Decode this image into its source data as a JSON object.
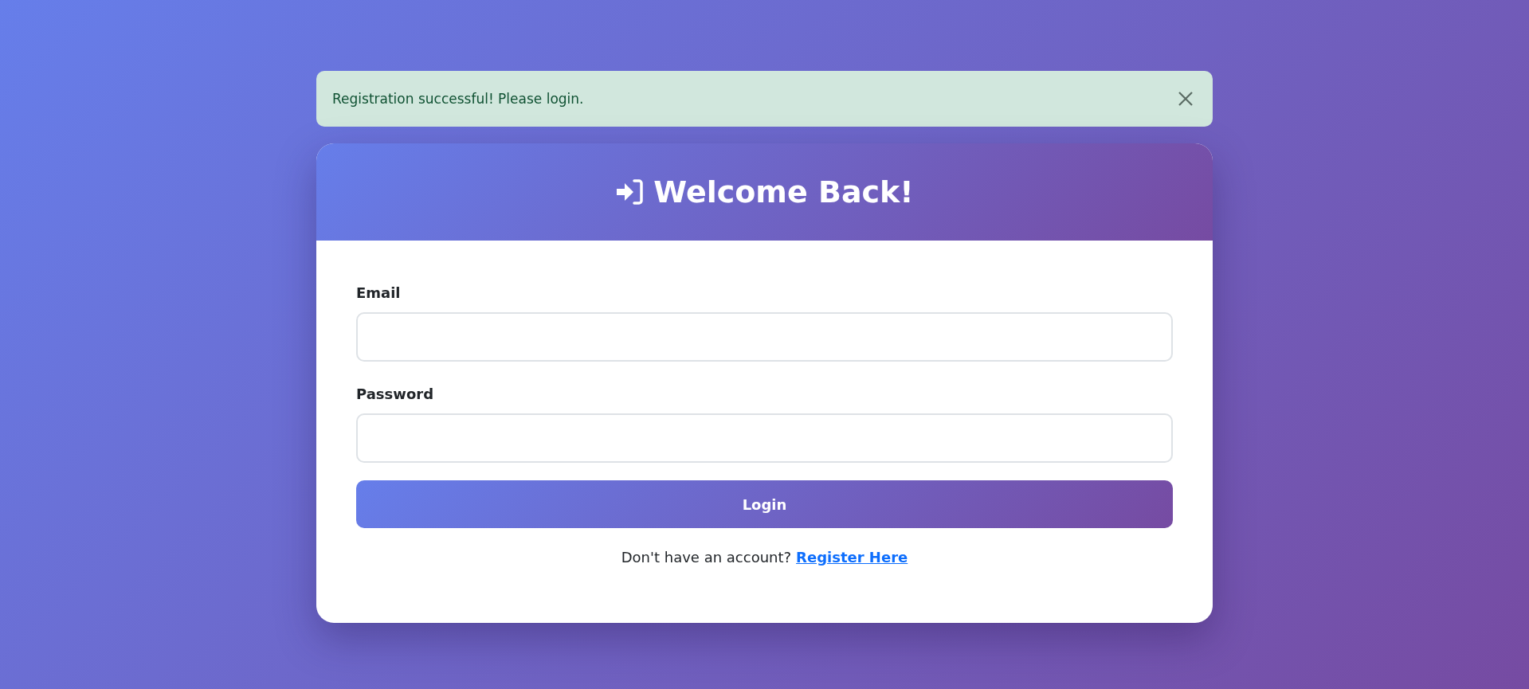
{
  "alert": {
    "message": "Registration successful! Please login.",
    "dismissible": true
  },
  "card": {
    "title": "Welcome Back!",
    "fields": [
      {
        "label": "Email"
      },
      {
        "label": "Password"
      }
    ],
    "submit": "Login",
    "footer": {
      "text": "Don't have an account?",
      "link": "Register Here"
    }
  }
}
